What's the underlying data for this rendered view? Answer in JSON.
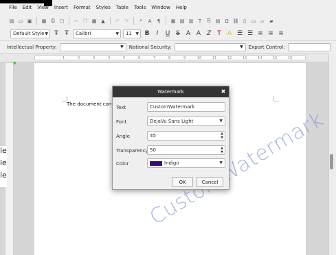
{
  "menubar": {
    "items": [
      "File",
      "Edit",
      "View",
      "Insert",
      "Format",
      "Styles",
      "Table",
      "Tools",
      "Window",
      "Help"
    ]
  },
  "toolbar2": {
    "paragraph_style": "Default Style",
    "font_name": "Calibri",
    "font_size": "11"
  },
  "classification": {
    "intellectual_property_label": "Intellectual Property:",
    "national_security_label": "National Security:",
    "export_control_label": "Export Control:"
  },
  "document": {
    "text": "The document contai",
    "watermark_text": "CustomWatermark",
    "left_fragments": [
      "le",
      "le",
      "le"
    ]
  },
  "ruler": {
    "numbers": [
      "1",
      "2",
      "3",
      "4",
      "5",
      "6",
      "7",
      "8",
      "9",
      "10",
      "11",
      "12",
      "13",
      "14",
      "15",
      "16",
      "17",
      "18"
    ]
  },
  "dialog": {
    "title": "Watermark",
    "close_glyph": "✖",
    "fields": {
      "text": {
        "label": "Text",
        "value": "CustomWatermark"
      },
      "font": {
        "label": "Font",
        "value": "DejaVu Sans Light"
      },
      "angle": {
        "label": "Angle",
        "value": "45"
      },
      "transparency": {
        "label": "Transparency",
        "value": "50"
      },
      "color": {
        "label": "Color",
        "value": "Indigo"
      }
    },
    "ok_label": "OK",
    "cancel_label": "Cancel"
  },
  "colors": {
    "watermark": "#6b82d6",
    "indigo": "#4b0082",
    "dialog_titlebar": "#353535"
  }
}
